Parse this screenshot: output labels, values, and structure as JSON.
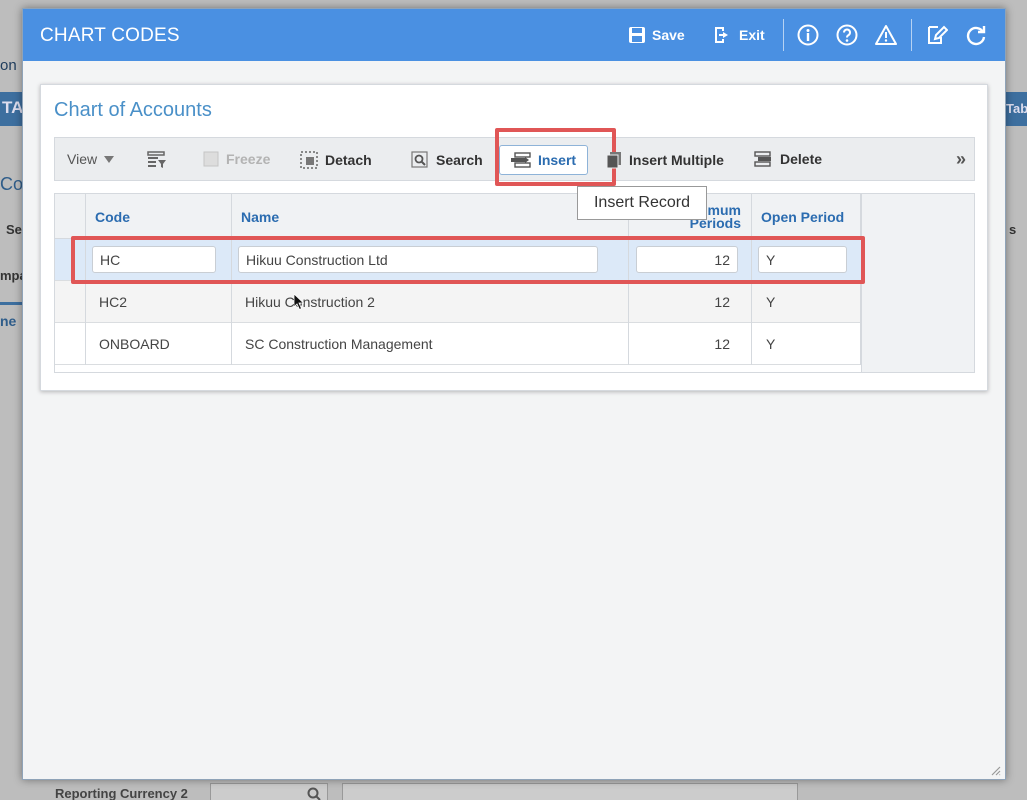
{
  "background": {
    "frag_on": "on",
    "frag_ta": "TA",
    "frag_co": "Co",
    "frag_se": "Se",
    "frag_mpa": "mpa",
    "frag_ne": "ne",
    "frag_tab": "Tab",
    "frag_s": "s",
    "reporting_currency_label": "Reporting Currency 2"
  },
  "modal": {
    "title": "CHART CODES",
    "header_buttons": {
      "save": "Save",
      "exit": "Exit"
    }
  },
  "panel": {
    "title": "Chart of Accounts"
  },
  "toolbar": {
    "view": "View",
    "freeze": "Freeze",
    "detach": "Detach",
    "search": "Search",
    "insert": "Insert",
    "insert_multiple": "Insert Multiple",
    "delete": "Delete"
  },
  "tooltip": {
    "text": "Insert Record"
  },
  "grid": {
    "columns": {
      "code": "Code",
      "name": "Name",
      "max_periods_1": "mum",
      "max_periods_2": "Periods",
      "open_period": "Open Period"
    },
    "rows": [
      {
        "code": "HC",
        "name": "Hikuu Construction Ltd",
        "periods": "12",
        "open": "Y"
      },
      {
        "code": "HC2",
        "name": "Hikuu Construction 2",
        "periods": "12",
        "open": "Y"
      },
      {
        "code": "ONBOARD",
        "name": "SC Construction Management",
        "periods": "12",
        "open": "Y"
      }
    ]
  },
  "colors": {
    "header_blue": "#4a90e2",
    "highlight_red": "#e05656",
    "link_blue": "#2b6cb0"
  }
}
